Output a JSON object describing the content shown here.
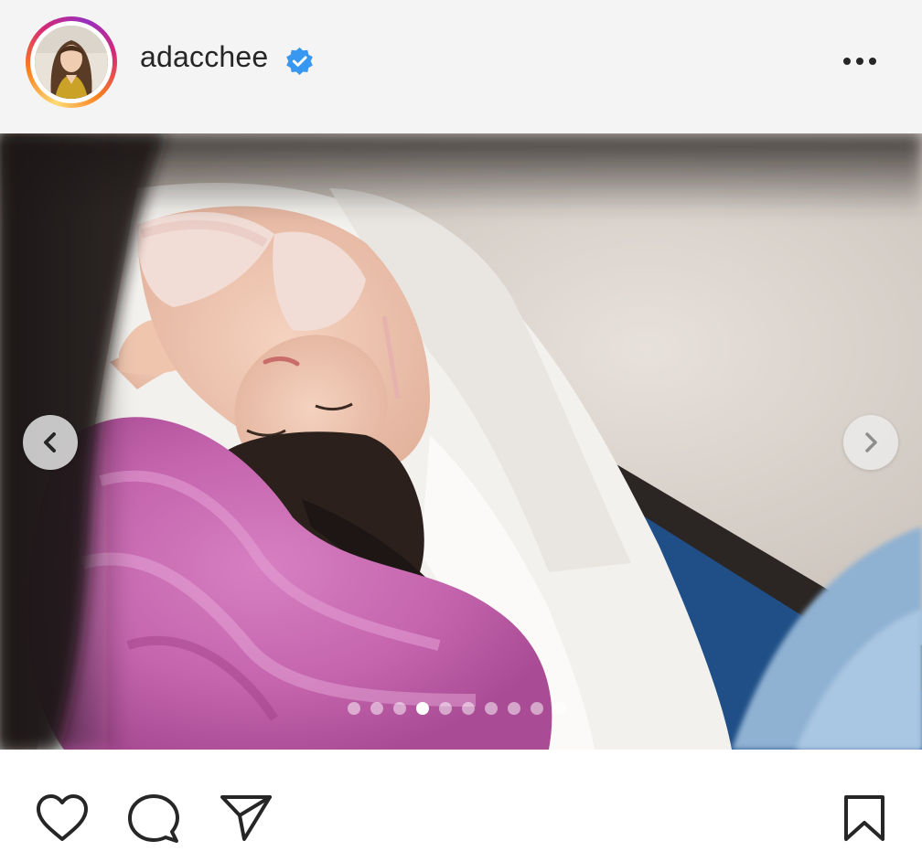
{
  "header": {
    "username": "adacchee",
    "verified": true,
    "avatar_icon": "profile-photo",
    "more_icon": "more-horizontal-icon",
    "story_ring_colors": [
      "#feda75",
      "#fa7e1e",
      "#d62976",
      "#962fbf"
    ],
    "verified_color": "#3897f0"
  },
  "media": {
    "type": "carousel-photo",
    "total_slides": 10,
    "active_slide": 4,
    "prev_icon": "chevron-left-icon",
    "next_icon": "chevron-right-icon"
  },
  "actions": {
    "like_icon": "heart-icon",
    "comment_icon": "comment-icon",
    "share_icon": "paper-plane-icon",
    "save_icon": "bookmark-icon"
  }
}
